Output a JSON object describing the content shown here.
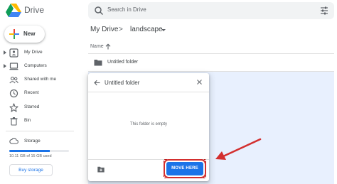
{
  "app": {
    "brand": "Drive"
  },
  "search": {
    "placeholder": "Search in Drive"
  },
  "sidebar": {
    "new_label": "New",
    "items": [
      {
        "label": "My Drive",
        "icon": "my-drive-icon",
        "expandable": true
      },
      {
        "label": "Computers",
        "icon": "computer-icon",
        "expandable": true
      },
      {
        "label": "Shared with me",
        "icon": "people-icon",
        "expandable": false
      },
      {
        "label": "Recent",
        "icon": "clock-icon",
        "expandable": false
      },
      {
        "label": "Starred",
        "icon": "star-icon",
        "expandable": false
      },
      {
        "label": "Bin",
        "icon": "trash-icon",
        "expandable": false
      }
    ],
    "storage": {
      "label": "Storage",
      "usage_text": "10.11 GB of 15 GB used",
      "used_fraction": 0.674,
      "buy_label": "Buy storage"
    }
  },
  "breadcrumb": {
    "root": "My Drive",
    "separator": ">",
    "current": "landscape"
  },
  "list": {
    "column_name": "Name",
    "rows": [
      {
        "name": "Untitled folder",
        "icon": "folder-icon"
      }
    ]
  },
  "dialog": {
    "title": "Untitled folder",
    "empty_text": "This folder is empty",
    "move_label": "MOVE HERE"
  },
  "colors": {
    "accent": "#1a73e8",
    "selection": "#e8f0fe",
    "annotation": "#d32f2f"
  }
}
